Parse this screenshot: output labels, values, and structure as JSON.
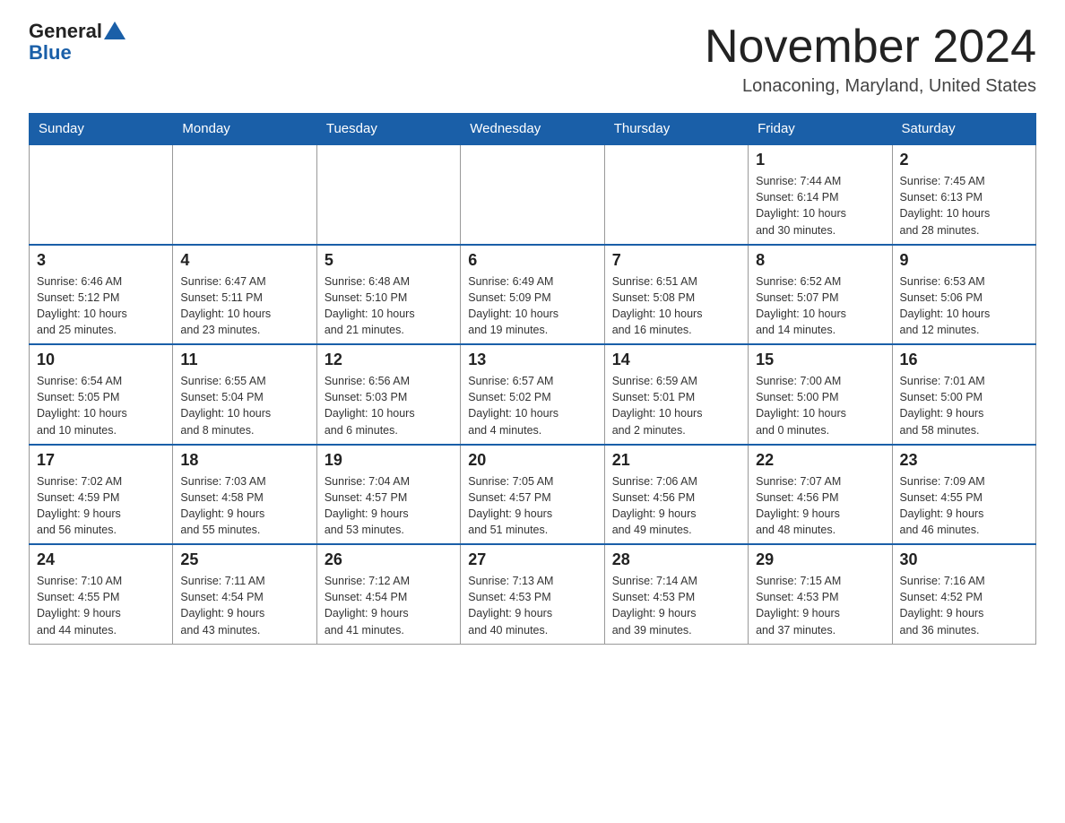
{
  "logo": {
    "general": "General",
    "blue": "Blue"
  },
  "header": {
    "title": "November 2024",
    "subtitle": "Lonaconing, Maryland, United States"
  },
  "weekdays": [
    "Sunday",
    "Monday",
    "Tuesday",
    "Wednesday",
    "Thursday",
    "Friday",
    "Saturday"
  ],
  "weeks": [
    [
      {
        "day": "",
        "info": ""
      },
      {
        "day": "",
        "info": ""
      },
      {
        "day": "",
        "info": ""
      },
      {
        "day": "",
        "info": ""
      },
      {
        "day": "",
        "info": ""
      },
      {
        "day": "1",
        "info": "Sunrise: 7:44 AM\nSunset: 6:14 PM\nDaylight: 10 hours\nand 30 minutes."
      },
      {
        "day": "2",
        "info": "Sunrise: 7:45 AM\nSunset: 6:13 PM\nDaylight: 10 hours\nand 28 minutes."
      }
    ],
    [
      {
        "day": "3",
        "info": "Sunrise: 6:46 AM\nSunset: 5:12 PM\nDaylight: 10 hours\nand 25 minutes."
      },
      {
        "day": "4",
        "info": "Sunrise: 6:47 AM\nSunset: 5:11 PM\nDaylight: 10 hours\nand 23 minutes."
      },
      {
        "day": "5",
        "info": "Sunrise: 6:48 AM\nSunset: 5:10 PM\nDaylight: 10 hours\nand 21 minutes."
      },
      {
        "day": "6",
        "info": "Sunrise: 6:49 AM\nSunset: 5:09 PM\nDaylight: 10 hours\nand 19 minutes."
      },
      {
        "day": "7",
        "info": "Sunrise: 6:51 AM\nSunset: 5:08 PM\nDaylight: 10 hours\nand 16 minutes."
      },
      {
        "day": "8",
        "info": "Sunrise: 6:52 AM\nSunset: 5:07 PM\nDaylight: 10 hours\nand 14 minutes."
      },
      {
        "day": "9",
        "info": "Sunrise: 6:53 AM\nSunset: 5:06 PM\nDaylight: 10 hours\nand 12 minutes."
      }
    ],
    [
      {
        "day": "10",
        "info": "Sunrise: 6:54 AM\nSunset: 5:05 PM\nDaylight: 10 hours\nand 10 minutes."
      },
      {
        "day": "11",
        "info": "Sunrise: 6:55 AM\nSunset: 5:04 PM\nDaylight: 10 hours\nand 8 minutes."
      },
      {
        "day": "12",
        "info": "Sunrise: 6:56 AM\nSunset: 5:03 PM\nDaylight: 10 hours\nand 6 minutes."
      },
      {
        "day": "13",
        "info": "Sunrise: 6:57 AM\nSunset: 5:02 PM\nDaylight: 10 hours\nand 4 minutes."
      },
      {
        "day": "14",
        "info": "Sunrise: 6:59 AM\nSunset: 5:01 PM\nDaylight: 10 hours\nand 2 minutes."
      },
      {
        "day": "15",
        "info": "Sunrise: 7:00 AM\nSunset: 5:00 PM\nDaylight: 10 hours\nand 0 minutes."
      },
      {
        "day": "16",
        "info": "Sunrise: 7:01 AM\nSunset: 5:00 PM\nDaylight: 9 hours\nand 58 minutes."
      }
    ],
    [
      {
        "day": "17",
        "info": "Sunrise: 7:02 AM\nSunset: 4:59 PM\nDaylight: 9 hours\nand 56 minutes."
      },
      {
        "day": "18",
        "info": "Sunrise: 7:03 AM\nSunset: 4:58 PM\nDaylight: 9 hours\nand 55 minutes."
      },
      {
        "day": "19",
        "info": "Sunrise: 7:04 AM\nSunset: 4:57 PM\nDaylight: 9 hours\nand 53 minutes."
      },
      {
        "day": "20",
        "info": "Sunrise: 7:05 AM\nSunset: 4:57 PM\nDaylight: 9 hours\nand 51 minutes."
      },
      {
        "day": "21",
        "info": "Sunrise: 7:06 AM\nSunset: 4:56 PM\nDaylight: 9 hours\nand 49 minutes."
      },
      {
        "day": "22",
        "info": "Sunrise: 7:07 AM\nSunset: 4:56 PM\nDaylight: 9 hours\nand 48 minutes."
      },
      {
        "day": "23",
        "info": "Sunrise: 7:09 AM\nSunset: 4:55 PM\nDaylight: 9 hours\nand 46 minutes."
      }
    ],
    [
      {
        "day": "24",
        "info": "Sunrise: 7:10 AM\nSunset: 4:55 PM\nDaylight: 9 hours\nand 44 minutes."
      },
      {
        "day": "25",
        "info": "Sunrise: 7:11 AM\nSunset: 4:54 PM\nDaylight: 9 hours\nand 43 minutes."
      },
      {
        "day": "26",
        "info": "Sunrise: 7:12 AM\nSunset: 4:54 PM\nDaylight: 9 hours\nand 41 minutes."
      },
      {
        "day": "27",
        "info": "Sunrise: 7:13 AM\nSunset: 4:53 PM\nDaylight: 9 hours\nand 40 minutes."
      },
      {
        "day": "28",
        "info": "Sunrise: 7:14 AM\nSunset: 4:53 PM\nDaylight: 9 hours\nand 39 minutes."
      },
      {
        "day": "29",
        "info": "Sunrise: 7:15 AM\nSunset: 4:53 PM\nDaylight: 9 hours\nand 37 minutes."
      },
      {
        "day": "30",
        "info": "Sunrise: 7:16 AM\nSunset: 4:52 PM\nDaylight: 9 hours\nand 36 minutes."
      }
    ]
  ]
}
